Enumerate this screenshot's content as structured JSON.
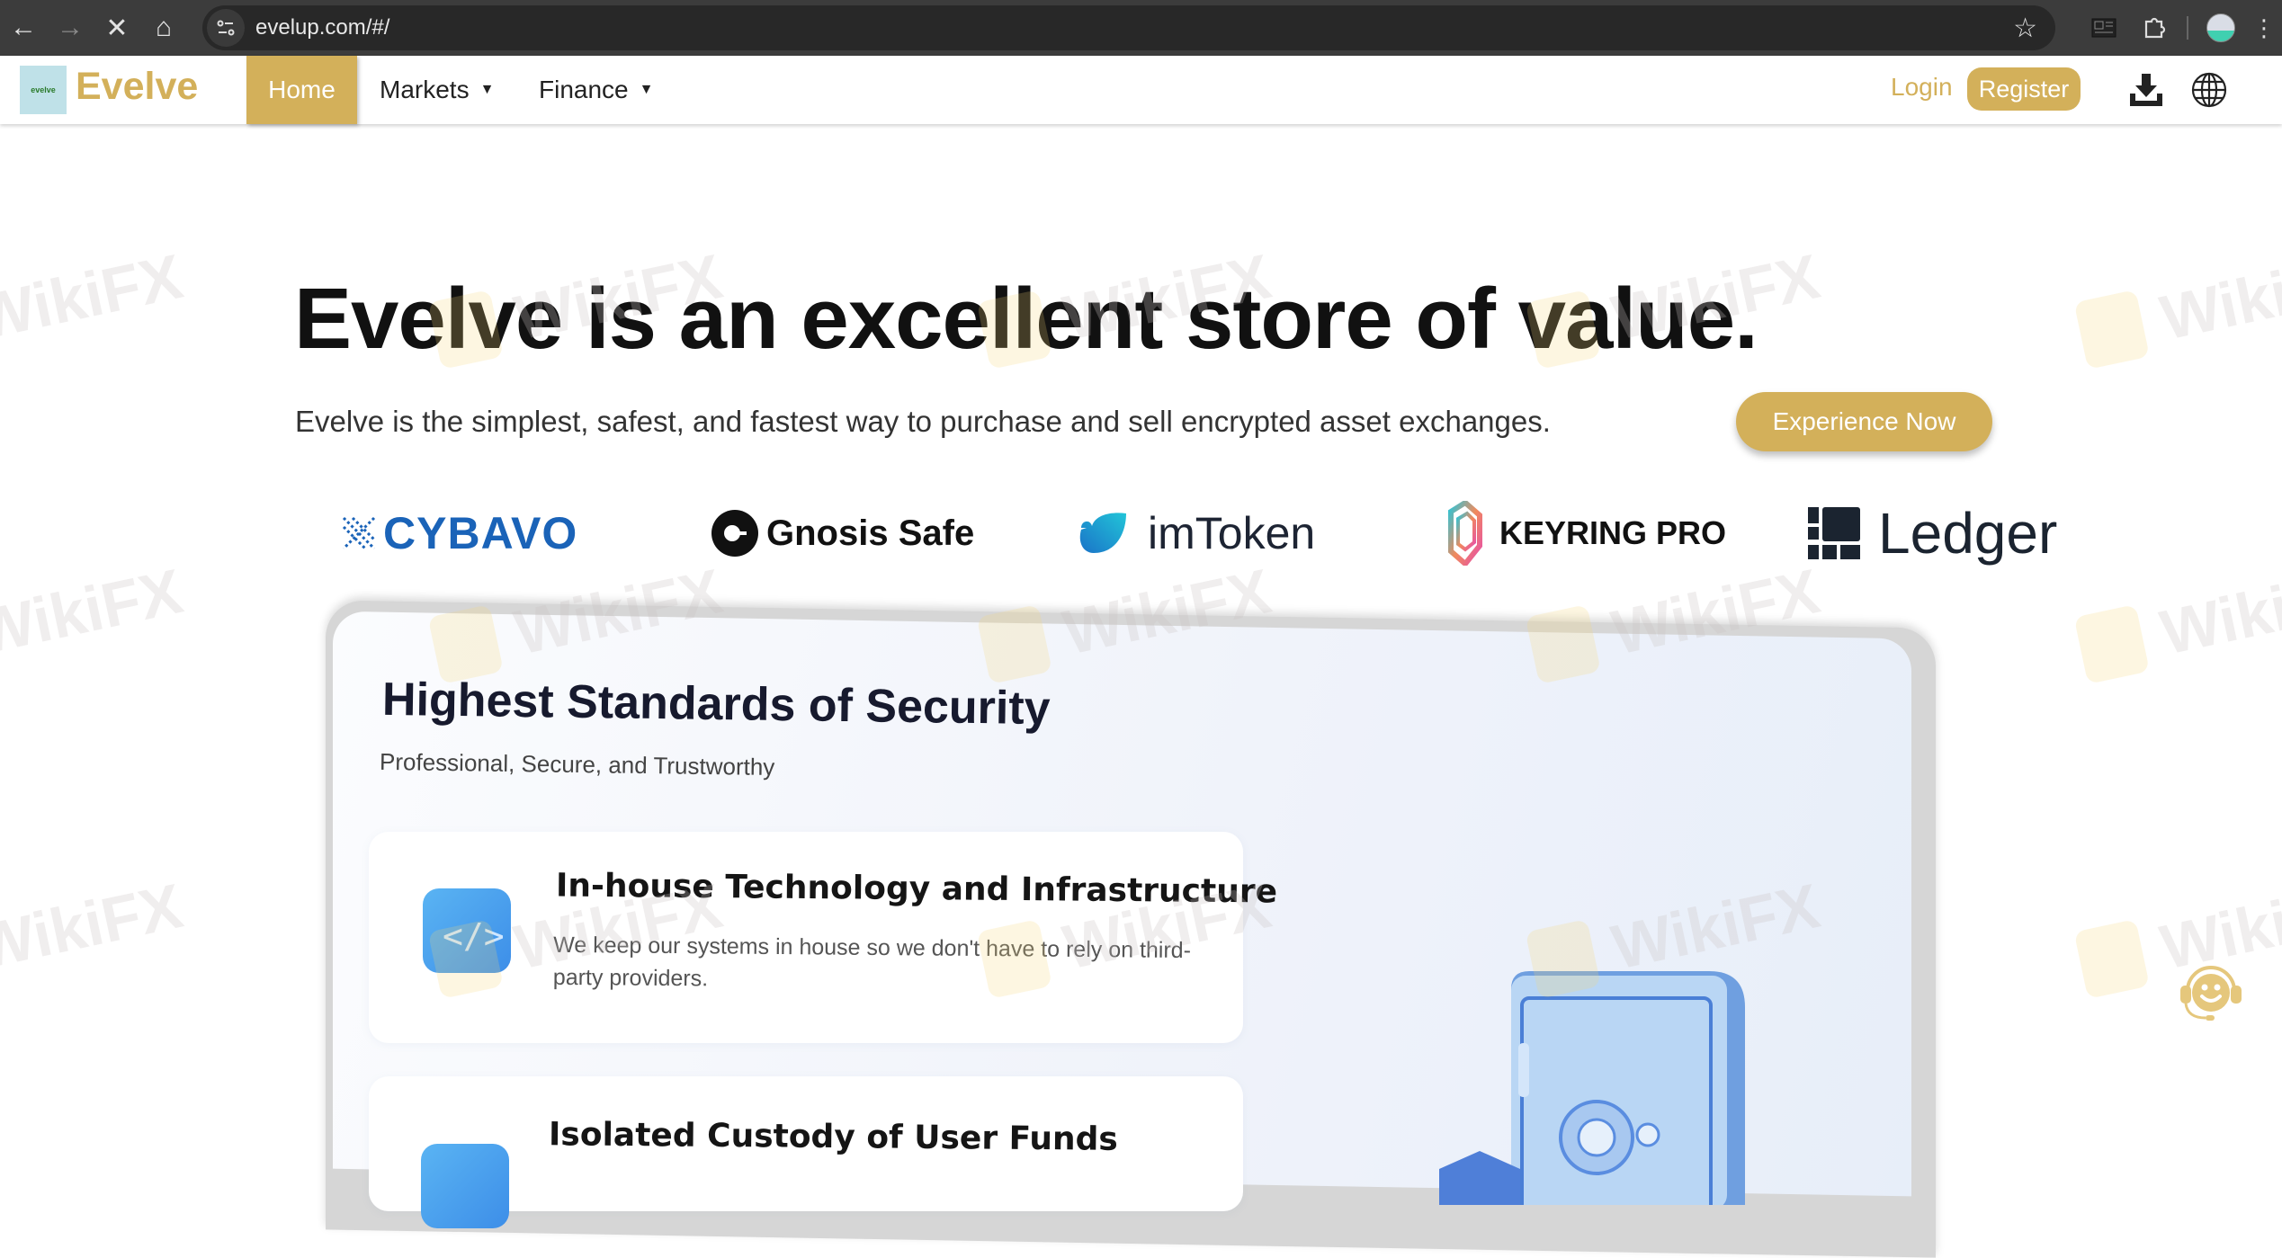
{
  "browser": {
    "url": "evelup.com/#/",
    "nav": {
      "back": "←",
      "forward": "→",
      "stop": "✕",
      "home": "⌂"
    },
    "icons": [
      "site-info-icon",
      "bookmark-star-icon",
      "reading-mode-icon",
      "extensions-icon",
      "profile-avatar",
      "menu-dots-icon"
    ]
  },
  "header": {
    "logo_mini_text": "evelve",
    "brand": "Evelve",
    "nav": [
      {
        "label": "Home",
        "active": true
      },
      {
        "label": "Markets",
        "dropdown": true
      },
      {
        "label": "Finance",
        "dropdown": true
      }
    ],
    "login": "Login",
    "register": "Register",
    "icons": [
      "download-icon",
      "globe-language-icon"
    ],
    "caret": "▼"
  },
  "hero": {
    "title": "Evelve is an excellent store of value.",
    "subtitle": "Evelve is the simplest, safest, and fastest way to purchase and sell encrypted asset exchanges.",
    "cta": "Experience Now"
  },
  "partners": [
    {
      "name": "CYBAVO"
    },
    {
      "name": "Gnosis Safe"
    },
    {
      "name": "imToken"
    },
    {
      "name": "KEYRING PRO"
    },
    {
      "name": "Ledger"
    }
  ],
  "security": {
    "title": "Highest Standards of Security",
    "subtitle": "Professional, Secure, and Trustworthy",
    "features": [
      {
        "title": "In-house Technology and Infrastructure",
        "desc": "We keep our systems in house so we don't have to rely on third-party providers.",
        "icon": "code-house-icon"
      },
      {
        "title": "Isolated Custody of User Funds",
        "desc": "",
        "icon": "custody-icon"
      }
    ]
  },
  "watermark": "WikiFX",
  "colors": {
    "brand_gold": "#d3b05a",
    "browser_bar": "#3c3c3c",
    "cybavo_blue": "#1a63b8"
  }
}
